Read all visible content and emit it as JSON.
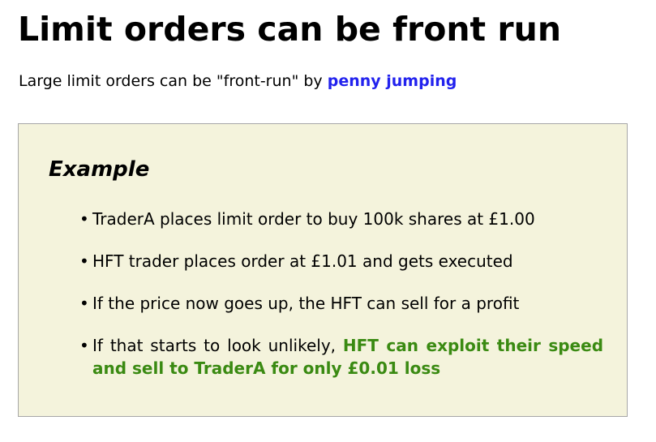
{
  "title": "Limit orders can be front run",
  "subtitle": {
    "text": "Large limit orders can be \"front-run\" by ",
    "link": "penny jumping"
  },
  "example": {
    "heading": "Example",
    "bullet_symbol": "•",
    "items": [
      {
        "text": "TraderA places limit order to buy 100k shares at £1.00"
      },
      {
        "text": "HFT trader places order at £1.01 and gets executed"
      },
      {
        "text": "If the price now goes up, the HFT can sell for a profit"
      },
      {
        "text": "If that starts to look unlikely, ",
        "highlight": "HFT can exploit their speed and sell to TraderA for only £0.01 loss"
      }
    ]
  },
  "colors": {
    "link": "#2222ee",
    "highlight": "#3a8a12",
    "box_background": "#f4f3dc",
    "box_border": "#a6a6a6"
  }
}
